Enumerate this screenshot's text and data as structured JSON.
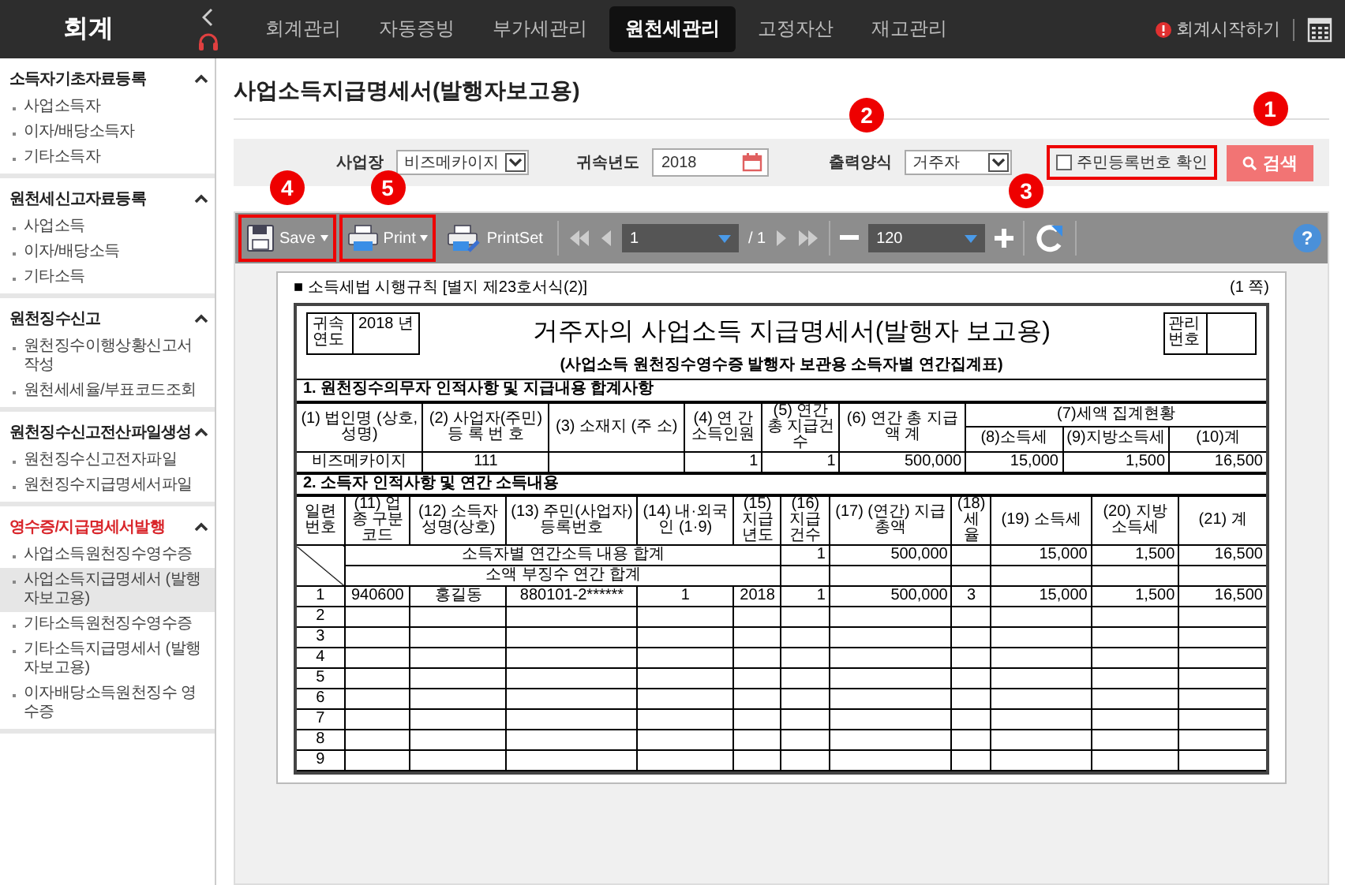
{
  "app": {
    "title": "회계"
  },
  "nav": [
    {
      "label": "회계관리",
      "selected": false
    },
    {
      "label": "자동증빙",
      "selected": false
    },
    {
      "label": "부가세관리",
      "selected": false
    },
    {
      "label": "원천세관리",
      "selected": true
    },
    {
      "label": "고정자산",
      "selected": false
    },
    {
      "label": "재고관리",
      "selected": false
    }
  ],
  "start_link": "회계시작하기",
  "sidebar": [
    {
      "title": "소득자기초자료등록",
      "active": false,
      "expanded": true,
      "items": [
        {
          "label": "사업소득자",
          "selected": false
        },
        {
          "label": "이자/배당소득자",
          "selected": false
        },
        {
          "label": "기타소득자",
          "selected": false
        }
      ]
    },
    {
      "title": "원천세신고자료등록",
      "active": false,
      "expanded": true,
      "items": [
        {
          "label": "사업소득",
          "selected": false
        },
        {
          "label": "이자/배당소득",
          "selected": false
        },
        {
          "label": "기타소득",
          "selected": false
        }
      ]
    },
    {
      "title": "원천징수신고",
      "active": false,
      "expanded": true,
      "items": [
        {
          "label": "원천징수이행상황신고서 작성",
          "selected": false
        },
        {
          "label": "원천세세율/부표코드조회",
          "selected": false
        }
      ]
    },
    {
      "title": "원천징수신고전산파일생성",
      "active": false,
      "expanded": true,
      "items": [
        {
          "label": "원천징수신고전자파일",
          "selected": false
        },
        {
          "label": "원천징수지급명세서파일",
          "selected": false
        }
      ]
    },
    {
      "title": "영수증/지급명세서발행",
      "active": true,
      "expanded": true,
      "items": [
        {
          "label": "사업소득원천징수영수증",
          "selected": false
        },
        {
          "label": "사업소득지급명세서 (발행자보고용)",
          "selected": true
        },
        {
          "label": "기타소득원천징수영수증",
          "selected": false
        },
        {
          "label": "기타소득지급명세서 (발행자보고용)",
          "selected": false
        },
        {
          "label": "이자배당소득원천징수 영수증",
          "selected": false
        }
      ]
    }
  ],
  "page_title": "사업소득지급명세서(발행자보고용)",
  "filters": {
    "workplace": {
      "label": "사업장",
      "value": "비즈메카이지"
    },
    "year": {
      "label": "귀속년도",
      "value": "2018"
    },
    "format": {
      "label": "출력양식",
      "value": "거주자",
      "callout": "2"
    },
    "rrn_check": {
      "label": "주민등록번호 확인",
      "checked": false,
      "callout": "3"
    },
    "search": {
      "label": "검색",
      "callout": "1"
    }
  },
  "viewer": {
    "save": {
      "label": "Save",
      "callout": "4"
    },
    "print": {
      "label": "Print",
      "callout": "5"
    },
    "printset": "PrintSet",
    "page": "1",
    "page_total": "/ 1",
    "zoom": "120",
    "help": "?"
  },
  "document": {
    "form_ref": "■ 소득세법 시행규칙 [별지 제23호서식(2)]",
    "page_note": "(1 쪽)",
    "year_label": "귀속연도",
    "year_value": "2018 년",
    "title": "거주자의 사업소득 지급명세서(발행자 보고용)",
    "manage_label": "관리번호",
    "subtitle": "(사업소득 원천징수영수증 발행자 보관용 소득자별 연간집계표)",
    "section1": {
      "title": "1. 원천징수의무자 인적사항 및 지급내용 합계사항",
      "columns": [
        "(1) 법인명 (상호,성명)",
        "(2) 사업자(주민) 등 록 번 호",
        "(3) 소재지 (주 소)",
        "(4) 연 간 소득인원",
        "(5) 연간 총 지급건수",
        "(6) 연간 총 지급액 계"
      ],
      "tax_group": "(7)세액 집계현황",
      "tax_columns": [
        "(8)소득세",
        "(9)지방소득세",
        "(10)계"
      ],
      "row": {
        "name": "비즈메카이지",
        "reg_no": "111",
        "people": "1",
        "count": "1",
        "total": "500,000",
        "tax": "15,000",
        "local_tax": "1,500",
        "sum": "16,500"
      }
    },
    "section2": {
      "title": "2. 소득자 인적사항 및 연간 소득내용",
      "columns": [
        "일련번호",
        "(11) 업종 구분코드",
        "(12) 소득자 성명(상호)",
        "(13) 주민(사업자) 등록번호",
        "(14) 내·외국인 (1·9)",
        "(15) 지급 년도",
        "(16) 지급 건수",
        "(17) (연간) 지급총액",
        "(18) 세율",
        "(19) 소득세",
        "(20) 지방 소득세",
        "(21) 계"
      ],
      "totals": [
        {
          "label": "소득자별 연간소득 내용 합계",
          "values": {
            "count": "1",
            "total": "500,000",
            "tax": "15,000",
            "local_tax": "1,500",
            "sum": "16,500"
          }
        },
        {
          "label": "소액 부징수 연간 합계"
        }
      ],
      "rows": [
        [
          "1",
          "940600",
          "홍길동",
          "880101-2******",
          "1",
          "2018",
          "1",
          "500,000",
          "3",
          "15,000",
          "1,500",
          "16,500"
        ],
        [
          "2"
        ],
        [
          "3"
        ],
        [
          "4"
        ],
        [
          "5"
        ],
        [
          "6"
        ],
        [
          "7"
        ],
        [
          "8"
        ],
        [
          "9"
        ]
      ]
    }
  }
}
